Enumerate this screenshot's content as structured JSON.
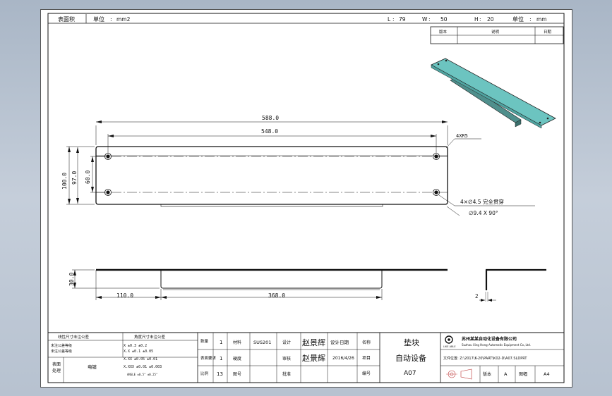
{
  "header": {
    "area_label": "表面积",
    "unit_label": "单位",
    "unit_value": "mm2",
    "l_label": "L",
    "l_value": "79",
    "w_label": "W",
    "w_value": "50",
    "h_label": "H",
    "h_value": "20",
    "unit2_label": "单位",
    "unit2_value": "mm"
  },
  "revision_table": {
    "col1": "版本",
    "col2": "说明",
    "col3": "日期"
  },
  "dimensions": {
    "overall_length": "588.0",
    "hole_spacing": "548.0",
    "radius_note": "4XR5",
    "overall_width": "100.0",
    "inner_width": "97.0",
    "hole_pitch": "60.0",
    "hole_note_1": "4×∅4.5 完全贯穿",
    "hole_note_2": "∅9.4 X 90°",
    "flange_height": "30.0",
    "left_segment": "110.0",
    "middle_segment": "368.0",
    "side_small": "2"
  },
  "title_block": {
    "tolerance_head_1": "线性尺寸未注公差",
    "tolerance_head_2": "角度尺寸未注公差",
    "tolerance_row_1": "X    ±0.3   ±0.2",
    "tolerance_row_2": "X.X    ±0.1   ±0.05",
    "tolerance_row_3": "X.XX    ±0.05   ±0.01",
    "tolerance_row_4": "X.XXX    ±0.01   ±0.003",
    "tolerance_row_5": "ANGLE ±0.5°   ±0.25°",
    "tolerance_sub_left": "未注公差等级",
    "tolerance_sub_right": "未注公差等级",
    "surface_label_1": "表面",
    "surface_label_2": "处理",
    "surface_value": "电镀",
    "label_qty": "数量",
    "label_material_req": "表面要求",
    "label_scale": "比例",
    "val_qty": "1",
    "val_mat": "1",
    "val_page": "13",
    "label_material": "材料",
    "label_hardness": "硬度",
    "label_page": "图号",
    "val_material": "SUS201",
    "label_design": "设计",
    "label_check": "审核",
    "label_approve": "批准",
    "designer": "赵景辉",
    "checker": "赵景辉",
    "label_design_date": "设计日期",
    "design_date": "2016/4/26",
    "label_name": "名称",
    "label_project": "项目",
    "label_drawing_no": "编号",
    "part_name": "垫块",
    "project_name": "自动设备",
    "drawing_no": "A07",
    "company_cn": "苏州某某自动化设备有限公司",
    "company_en": "Suzhou Xing Hong Automatic Equipment Co.,Ltd.",
    "logo_text": "LIKE ABLE",
    "file_path": "文件位置: Z:\\2017\\K-20\\PART\\K02-D\\A07.SLDPRT",
    "label_version": "版本",
    "version_value": "A",
    "label_sheet": "图幅",
    "sheet_value": "A4"
  }
}
